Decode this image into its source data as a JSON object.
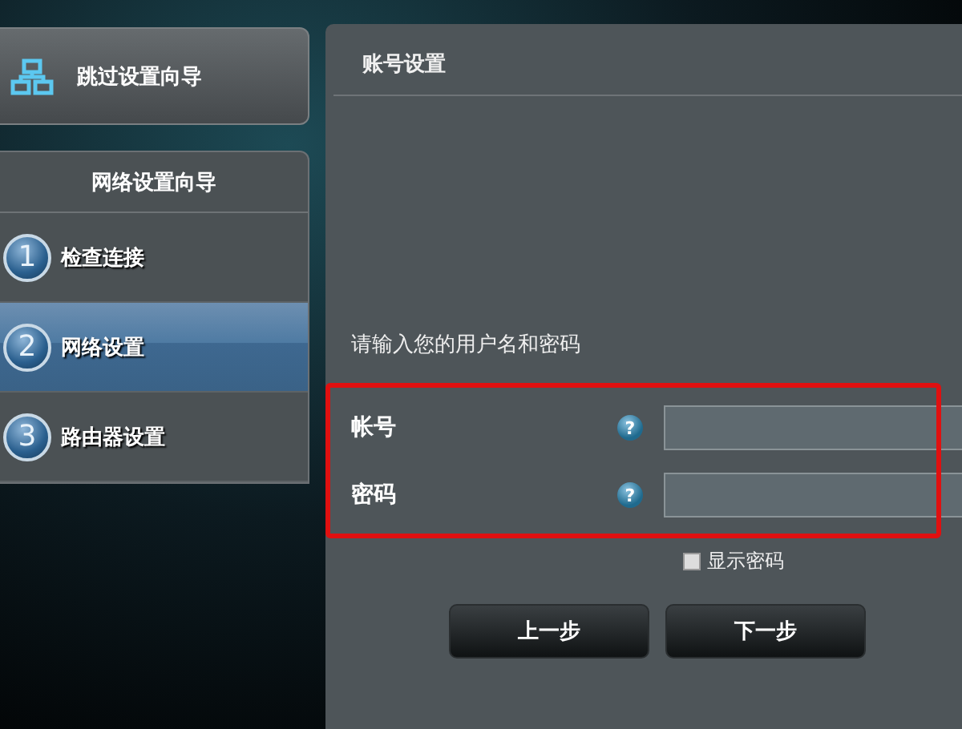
{
  "skip_wizard": {
    "label": "跳过设置向导"
  },
  "wizard": {
    "title": "网络设置向导",
    "steps": [
      {
        "number": "1",
        "label": "检查连接",
        "selected": false
      },
      {
        "number": "2",
        "label": "网络设置",
        "selected": true
      },
      {
        "number": "3",
        "label": "路由器设置",
        "selected": false
      }
    ]
  },
  "account": {
    "title": "账号设置",
    "prompt": "请输入您的用户名和密码",
    "fields": [
      {
        "label": "帐号",
        "help": "?"
      },
      {
        "label": "密码",
        "help": "?"
      }
    ],
    "show_password": {
      "label": "显示密码",
      "checked": false
    },
    "buttons": [
      "上一步",
      "下一步"
    ]
  }
}
